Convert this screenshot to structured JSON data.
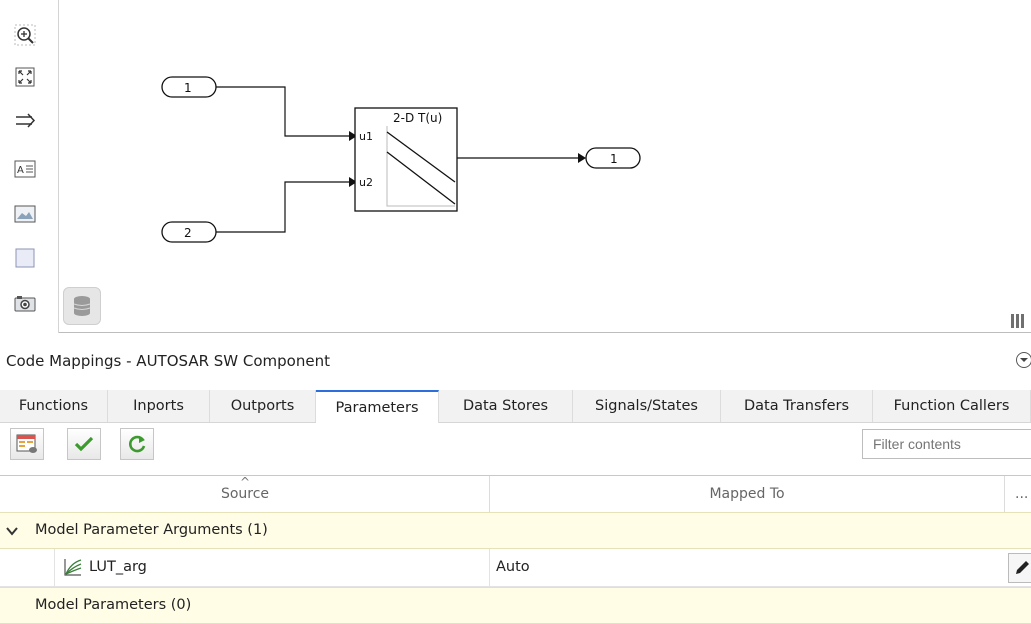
{
  "diagram": {
    "inport_1": "1",
    "inport_2": "2",
    "lookup_block": {
      "title": "2-D T(u)",
      "port_u1": "u1",
      "port_u2": "u2"
    },
    "outport_1": "1"
  },
  "palette": {
    "items": [
      "zoom-icon",
      "fit-to-view-icon",
      "signal-routing-icon",
      "annotation-icon",
      "image-icon",
      "area-icon",
      "screenshot-icon"
    ]
  },
  "code_mappings": {
    "title": "Code Mappings - AUTOSAR SW Component",
    "tabs": [
      "Functions",
      "Inports",
      "Outports",
      "Parameters",
      "Data Stores",
      "Signals/States",
      "Data Transfers",
      "Function Callers"
    ],
    "active_tab": "Parameters",
    "filter_placeholder": "Filter contents",
    "columns": {
      "source": "Source",
      "mapped_to": "Mapped To",
      "more": "..."
    },
    "groups": [
      {
        "label": "Model Parameter Arguments (1)",
        "expanded": true,
        "rows": [
          {
            "source": "LUT_arg",
            "mapped_to": "Auto"
          }
        ]
      },
      {
        "label": "Model Parameters (0)",
        "expanded": false,
        "rows": []
      }
    ]
  },
  "colors": {
    "accent": "#2a6fdb",
    "group_bg": "#fffde6"
  }
}
